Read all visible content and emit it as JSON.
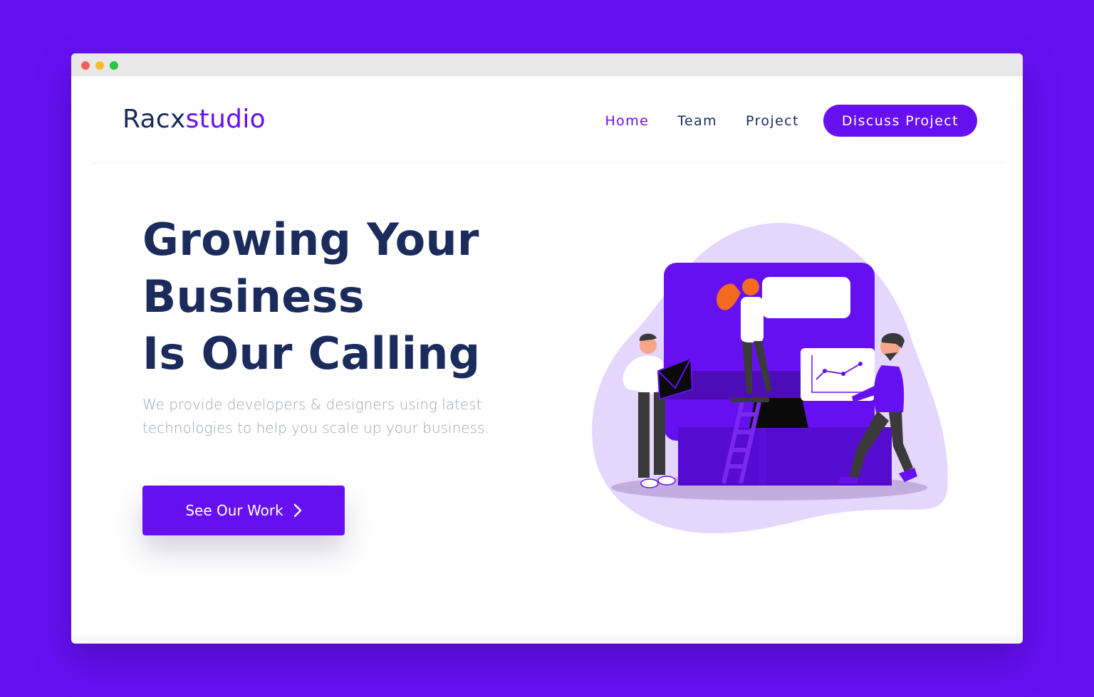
{
  "browser": {
    "dots": [
      "close",
      "minimize",
      "maximize"
    ]
  },
  "brand": {
    "logo_main": "Racx",
    "logo_accent": "studio"
  },
  "nav": {
    "items": [
      {
        "label": "Home",
        "active": true
      },
      {
        "label": "Team",
        "active": false
      },
      {
        "label": "Project",
        "active": false
      }
    ],
    "cta_label": "Discuss Project"
  },
  "hero": {
    "title_lines": [
      "Growing Your",
      "Business",
      "Is Our Calling"
    ],
    "subtitle": "We provide developers & designers using latest technologies to help you scale up your business.",
    "button_label": "See Our Work",
    "button_icon": "chevron-right-icon"
  },
  "illustration": {
    "name": "team-working-illustration"
  },
  "colors": {
    "background": "#6610f2",
    "accent": "#6610f2",
    "heading": "#1a2b5c",
    "muted": "#a0a4b2",
    "blob": "#e4d6fd"
  }
}
